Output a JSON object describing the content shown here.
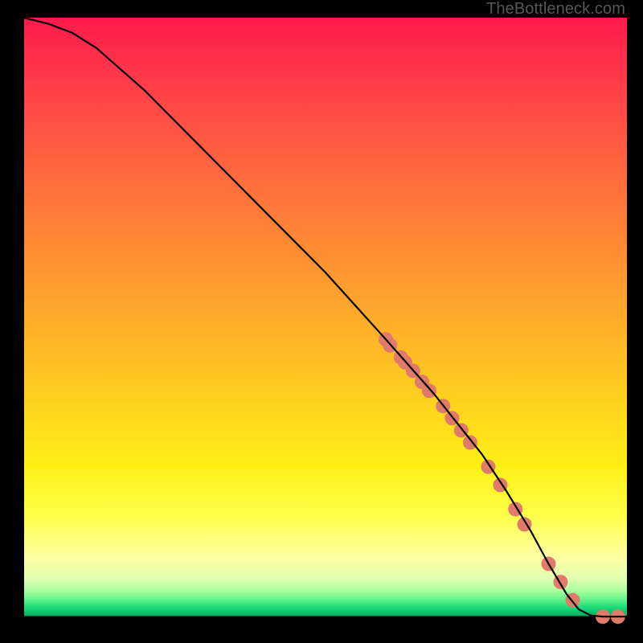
{
  "attribution": "TheBottleneck.com",
  "chart_data": {
    "type": "line",
    "xlim": [
      0,
      100
    ],
    "ylim": [
      0,
      100
    ],
    "series": [
      {
        "name": "bottleneck-curve",
        "x": [
          0,
          4,
          8,
          12,
          20,
          30,
          40,
          50,
          60,
          68,
          72,
          76,
          80,
          84,
          87,
          90,
          92,
          94,
          96,
          98,
          100
        ],
        "values": [
          100,
          99,
          97.5,
          95,
          88,
          78,
          68,
          58,
          47,
          38,
          33,
          28,
          22,
          15.5,
          10,
          5,
          2.5,
          1.5,
          1.3,
          1.3,
          1.3
        ]
      }
    ],
    "markers": {
      "name": "highlighted-points",
      "color": "#e07a6a",
      "x": [
        60,
        60.7,
        62.5,
        63.2,
        64.5,
        66,
        67.2,
        69.5,
        71,
        72.5,
        74,
        77,
        79,
        81.5,
        83,
        87,
        89,
        91,
        96,
        98.5
      ],
      "values": [
        47,
        46,
        44,
        43.2,
        41.8,
        40,
        38.5,
        36,
        34,
        32,
        30,
        26,
        23,
        19,
        16.5,
        10,
        7,
        4,
        1.3,
        1.3
      ]
    }
  }
}
